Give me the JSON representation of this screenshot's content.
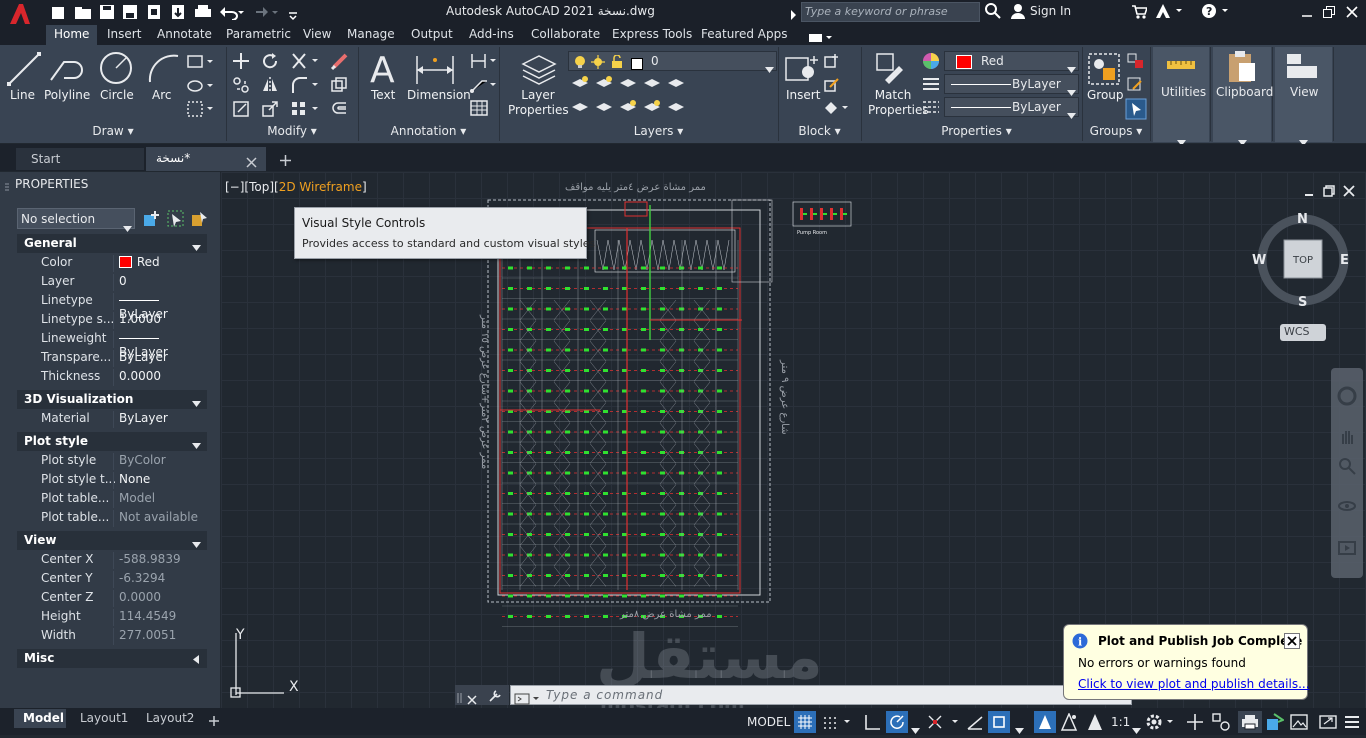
{
  "titlebar": {
    "title": "Autodesk AutoCAD 2021  نسخة.dwg",
    "search_placeholder": "Type a keyword or phrase",
    "sign_in": "Sign In"
  },
  "ribbon_tabs": [
    "Home",
    "Insert",
    "Annotate",
    "Parametric",
    "View",
    "Manage",
    "Output",
    "Add-ins",
    "Collaborate",
    "Express Tools",
    "Featured Apps"
  ],
  "draw": {
    "line": "Line",
    "polyline": "Polyline",
    "circle": "Circle",
    "arc": "Arc",
    "panel": "Draw"
  },
  "modify": {
    "panel": "Modify"
  },
  "annotation": {
    "text": "Text",
    "dimension": "Dimension",
    "panel": "Annotation"
  },
  "layers": {
    "properties": "Layer Properties",
    "current_layer": "0",
    "panel": "Layers"
  },
  "block": {
    "insert": "Insert",
    "panel": "Block"
  },
  "properties_panel": {
    "match": "Match Properties",
    "color": "Red",
    "linetype": "ByLayer",
    "lineweight": "ByLayer",
    "panel": "Properties"
  },
  "groups": {
    "group": "Group",
    "panel": "Groups"
  },
  "utilities": "Utilities",
  "clipboard": "Clipboard",
  "view_btn": "View",
  "doc_tabs": {
    "start": "Start",
    "file": "نسخة*"
  },
  "palette": {
    "title": "PROPERTIES",
    "selection": "No selection",
    "general": "General",
    "color_k": "Color",
    "color_v": "Red",
    "layer_k": "Layer",
    "layer_v": "0",
    "linetype_k": "Linetype",
    "linetype_v": "ByLayer",
    "ltscale_k": "Linetype s...",
    "ltscale_v": "1.0000",
    "lineweight_k": "Lineweight",
    "lineweight_v": "ByLayer",
    "transp_k": "Transpare...",
    "transp_v": "ByLayer",
    "thickness_k": "Thickness",
    "thickness_v": "0.0000",
    "viz": "3D Visualization",
    "material_k": "Material",
    "material_v": "ByLayer",
    "plot": "Plot style",
    "ps_k": "Plot style",
    "ps_v": "ByColor",
    "pst_k": "Plot style t...",
    "pst_v": "None",
    "pt1_k": "Plot table...",
    "pt1_v": "Model",
    "pt2_k": "Plot table...",
    "pt2_v": "Not available",
    "view": "View",
    "cx_k": "Center X",
    "cx_v": "-588.9839",
    "cy_k": "Center Y",
    "cy_v": "-6.3294",
    "cz_k": "Center Z",
    "cz_v": "0.0000",
    "h_k": "Height",
    "h_v": "114.4549",
    "w_k": "Width",
    "w_v": "277.0051",
    "misc": "Misc"
  },
  "viewport": {
    "label_a": "[−][Top][",
    "label_b": "2D Wireframe",
    "label_c": "]"
  },
  "tooltip": {
    "title": "Visual Style Controls",
    "body": "Provides access to standard and custom visual styles."
  },
  "viewcube": {
    "n": "N",
    "s": "S",
    "e": "E",
    "w": "W",
    "top": "TOP",
    "wcs": "WCS"
  },
  "drawing_text": {
    "top": "ممر مشاة عرض ٤متر يليه مواقف",
    "bottom": "ممر مشاة عرض ٨متر",
    "left": "ممر عرض ٢متر+شارع عرض ١٥ متر",
    "right": "شارع عرض ٩ متر",
    "legend": "Pump Room"
  },
  "ucs": {
    "x": "X",
    "y": "Y"
  },
  "command": {
    "placeholder": "Type a command"
  },
  "notification": {
    "title": "Plot and Publish Job Complete",
    "body": "No errors or warnings found",
    "link": "Click to view plot and publish details..."
  },
  "layout_tabs": [
    "Model",
    "Layout1",
    "Layout2"
  ],
  "status": {
    "model": "MODEL",
    "scale": "1:1"
  },
  "watermark": {
    "arabic": "مستقل",
    "latin": "mostaql.com"
  }
}
